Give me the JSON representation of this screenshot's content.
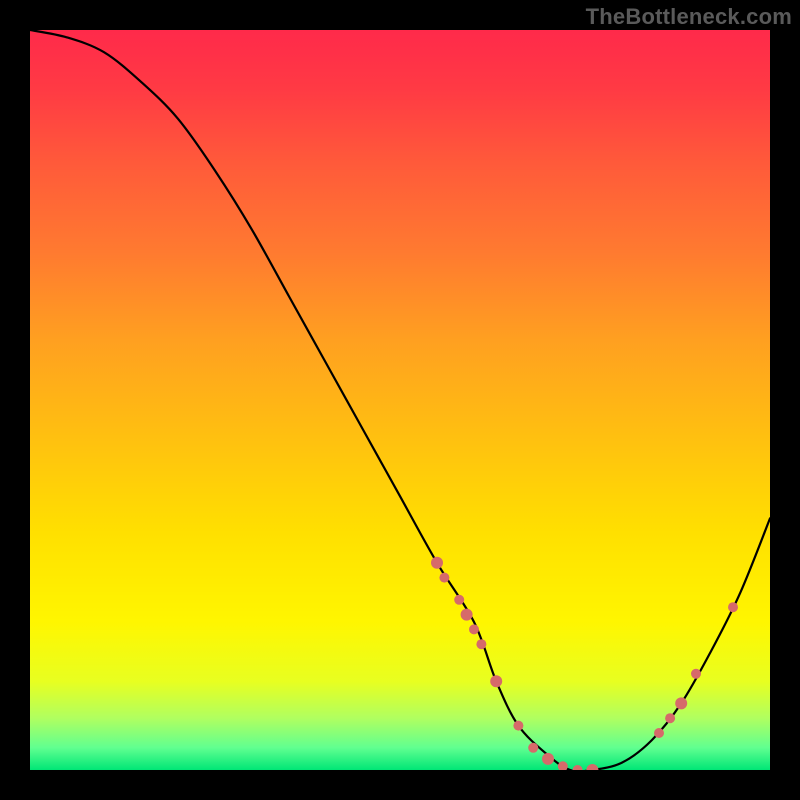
{
  "watermark": "TheBottleneck.com",
  "chart_data": {
    "type": "line",
    "title": "",
    "xlabel": "",
    "ylabel": "",
    "xlim": [
      0,
      100
    ],
    "ylim": [
      0,
      100
    ],
    "grid": false,
    "series": [
      {
        "name": "bottleneck-curve",
        "x": [
          0,
          5,
          10,
          15,
          20,
          25,
          30,
          35,
          40,
          45,
          50,
          55,
          60,
          63,
          66,
          70,
          73,
          76,
          80,
          84,
          88,
          92,
          96,
          100
        ],
        "y": [
          100,
          99,
          97,
          93,
          88,
          81,
          73,
          64,
          55,
          46,
          37,
          28,
          20,
          12,
          6,
          2,
          0,
          0,
          1,
          4,
          9,
          16,
          24,
          34
        ]
      }
    ],
    "highlight_points": {
      "name": "dotted-segment-markers",
      "color": "#d66a6a",
      "points": [
        {
          "x": 55,
          "y": 28
        },
        {
          "x": 56,
          "y": 26
        },
        {
          "x": 58,
          "y": 23
        },
        {
          "x": 59,
          "y": 21
        },
        {
          "x": 60,
          "y": 19
        },
        {
          "x": 61,
          "y": 17
        },
        {
          "x": 63,
          "y": 12
        },
        {
          "x": 66,
          "y": 6
        },
        {
          "x": 68,
          "y": 3
        },
        {
          "x": 70,
          "y": 1.5
        },
        {
          "x": 72,
          "y": 0.5
        },
        {
          "x": 74,
          "y": 0
        },
        {
          "x": 76,
          "y": 0
        },
        {
          "x": 85,
          "y": 5
        },
        {
          "x": 86.5,
          "y": 7
        },
        {
          "x": 88,
          "y": 9
        },
        {
          "x": 90,
          "y": 13
        },
        {
          "x": 95,
          "y": 22
        }
      ]
    },
    "background_gradient": {
      "top": "#ff2a4a",
      "mid": "#ffe000",
      "bottom": "#00e676"
    }
  }
}
